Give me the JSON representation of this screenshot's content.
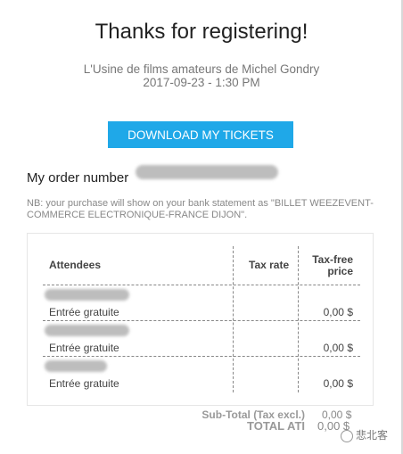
{
  "header": {
    "title": "Thanks for registering!",
    "event_name": "L'Usine de films amateurs de Michel Gondry",
    "event_datetime": "2017-09-23 - 1:30 PM"
  },
  "actions": {
    "download_label": "DOWNLOAD MY TICKETS"
  },
  "order": {
    "label": "My order number",
    "note": "NB: your purchase will show on your bank statement as \"BILLET WEEZEVENT-COMMERCE ELECTRONIQUE-FRANCE DIJON\"."
  },
  "table": {
    "headers": {
      "attendees": "Attendees",
      "tax_rate": "Tax rate",
      "price_line1": "Tax-free",
      "price_line2": "price"
    },
    "rows": [
      {
        "ticket": "Entrée gratuite",
        "tax_rate": "",
        "price": "0,00 $"
      },
      {
        "ticket": "Entrée gratuite",
        "tax_rate": "",
        "price": "0,00 $"
      },
      {
        "ticket": "Entrée gratuite",
        "tax_rate": "",
        "price": "0,00 $"
      }
    ]
  },
  "totals": {
    "subtotal_label": "Sub-Total (Tax excl.)",
    "subtotal_value": "0,00 $",
    "total_label": "TOTAL ATI",
    "total_value": "0,00 $"
  },
  "watermark": {
    "text": "悲北客"
  },
  "colors": {
    "button": "#1fa8e8",
    "text": "#333333",
    "muted": "#888888"
  }
}
